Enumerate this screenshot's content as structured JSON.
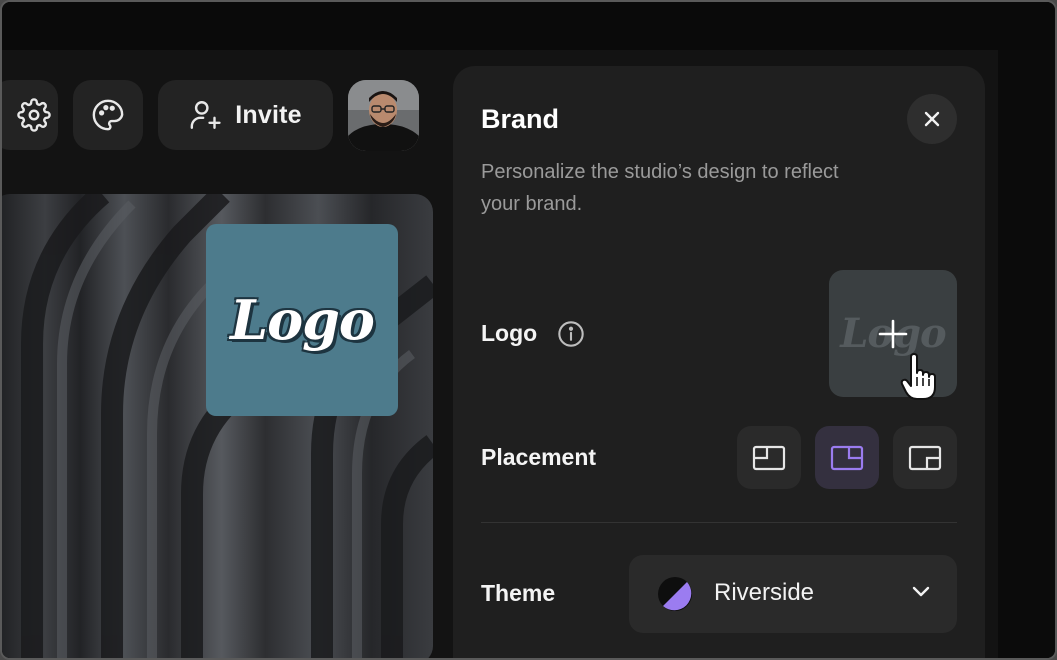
{
  "toolbar": {
    "invite_label": "Invite",
    "icons": [
      "gear-icon",
      "palette-icon",
      "user-plus-icon"
    ]
  },
  "stage": {
    "logo_text": "Logo",
    "logo_bg": "#4d7b8c"
  },
  "panel": {
    "title": "Brand",
    "description": "Personalize the studio’s design to reflect your brand.",
    "logo_label": "Logo",
    "logo_placeholder_text": "Logo",
    "placement_label": "Placement",
    "placement_options": [
      "top-left",
      "top-right",
      "bottom-right"
    ],
    "placement_selected": "top-right",
    "theme_label": "Theme",
    "theme_value": "Riverside",
    "accent": "#9b7cf0"
  }
}
